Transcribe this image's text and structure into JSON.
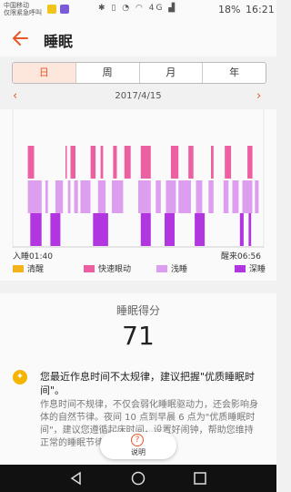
{
  "status_bar": {
    "carrier_line1": "中国移动",
    "carrier_line2": "仅限紧急呼叫",
    "battery": "18%",
    "time": "16:21",
    "network": "4G"
  },
  "header": {
    "title": "睡眠"
  },
  "tabs": [
    {
      "label": "日",
      "active": true
    },
    {
      "label": "周",
      "active": false
    },
    {
      "label": "月",
      "active": false
    },
    {
      "label": "年",
      "active": false
    }
  ],
  "date": "2017/4/15",
  "chart_data": {
    "type": "bar",
    "sleep_start_label": "入睡01:40",
    "wake_label": "醒来06:56",
    "legend": [
      {
        "name": "清醒",
        "color": "#f5b21f"
      },
      {
        "name": "快速眼动",
        "color": "#ec5fa0"
      },
      {
        "name": "浅睡",
        "color": "#dd9ef0"
      },
      {
        "name": "深睡",
        "color": "#b236e0"
      }
    ],
    "stage_colors": {
      "rem": "#ec5fa0",
      "light": "#dd9ef0",
      "deep": "#b236e0"
    },
    "timeline_fractions": {
      "rem": [
        [
          0.06,
          0.085
        ],
        [
          0.21,
          0.215
        ],
        [
          0.23,
          0.25
        ],
        [
          0.31,
          0.33
        ],
        [
          0.35,
          0.36
        ],
        [
          0.4,
          0.415
        ],
        [
          0.445,
          0.47
        ],
        [
          0.51,
          0.55
        ],
        [
          0.63,
          0.66
        ],
        [
          0.7,
          0.72
        ],
        [
          0.79,
          0.8
        ],
        [
          0.845,
          0.87
        ],
        [
          0.935,
          0.955
        ]
      ],
      "light": [
        [
          0.06,
          0.115
        ],
        [
          0.13,
          0.14
        ],
        [
          0.17,
          0.2
        ],
        [
          0.22,
          0.23
        ],
        [
          0.245,
          0.26
        ],
        [
          0.27,
          0.31
        ],
        [
          0.34,
          0.37
        ],
        [
          0.395,
          0.44
        ],
        [
          0.5,
          0.55
        ],
        [
          0.57,
          0.59
        ],
        [
          0.61,
          0.65
        ],
        [
          0.66,
          0.71
        ],
        [
          0.73,
          0.755
        ],
        [
          0.78,
          0.8
        ],
        [
          0.84,
          0.86
        ],
        [
          0.875,
          0.9
        ],
        [
          0.915,
          0.955
        ],
        [
          0.965,
          0.98
        ]
      ],
      "deep": [
        [
          0.07,
          0.115
        ],
        [
          0.15,
          0.19
        ],
        [
          0.32,
          0.38
        ],
        [
          0.51,
          0.55
        ],
        [
          0.605,
          0.645
        ],
        [
          0.725,
          0.765
        ],
        [
          0.905,
          0.92
        ],
        [
          0.94,
          0.95
        ]
      ]
    }
  },
  "score": {
    "label": "睡眠得分",
    "value": "71"
  },
  "tip": {
    "title": "您最近作息时间不太规律，建议把握\"优质睡眠时间\"。",
    "body": "作息时间不规律，不仅会弱化睡眠驱动力，还会影响身体的自然节律。夜间 10 点到早晨 6 点为\"优质睡眠时间\"，建议您遵循起床时间，设置好闹钟，帮助您维持正常的睡眠节律。"
  },
  "explain_button": {
    "label": "说明"
  }
}
